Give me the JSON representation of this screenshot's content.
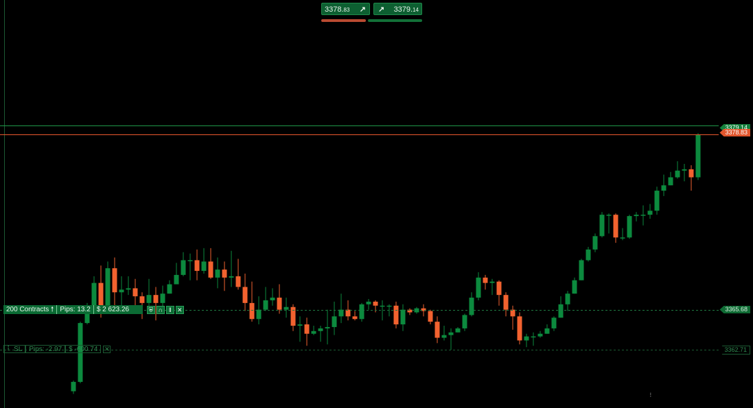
{
  "quote": {
    "sell": {
      "main": "3378.",
      "frac": "83"
    },
    "buy": {
      "main": "3379.",
      "frac": "14"
    }
  },
  "order": {
    "contracts_label": "200 Contracts",
    "pips_label": "Pips: 13.2",
    "pnl_label": "$ 2 623.26",
    "icons": [
      "shield-icon",
      "magnet-icon",
      "pause-icon",
      "close-icon"
    ]
  },
  "stop_loss": {
    "label": "SL",
    "pips_label": "Pips: -2.97",
    "pnl_label": "$ -600.74"
  },
  "price_tags": {
    "ask": "3379.14",
    "bid": "3378.83",
    "entry": "3365.68",
    "stop_loss": "3362.71"
  },
  "colors": {
    "bull": "#0c8a3e",
    "bear": "#f2622f",
    "ask_line": "#1f9a4a",
    "bid_line": "#ef5a2e"
  },
  "chart_data": {
    "type": "candlestick",
    "price_levels": {
      "ask": 3379.14,
      "bid": 3378.83,
      "entry": 3365.68,
      "stop_loss": 3362.71
    },
    "candles": [
      [
        3359.6,
        3360.3,
        3359.4,
        3360.4
      ],
      [
        3360.3,
        3364.7,
        3360.2,
        3364.8
      ],
      [
        3364.7,
        3365.8,
        3364.6,
        3366.2
      ],
      [
        3365.8,
        3367.7,
        3365.8,
        3368.2
      ],
      [
        3367.7,
        3365.8,
        3365.1,
        3369.0
      ],
      [
        3365.8,
        3368.8,
        3365.5,
        3369.3
      ],
      [
        3368.8,
        3367.0,
        3365.8,
        3369.6
      ],
      [
        3367.0,
        3367.2,
        3365.8,
        3368.2
      ],
      [
        3367.2,
        3367.3,
        3366.8,
        3368.2
      ],
      [
        3367.3,
        3366.7,
        3365.8,
        3368.0
      ],
      [
        3366.7,
        3366.2,
        3365.0,
        3367.0
      ],
      [
        3366.2,
        3366.8,
        3366.0,
        3368.0
      ],
      [
        3366.8,
        3366.2,
        3364.9,
        3367.4
      ],
      [
        3366.2,
        3366.9,
        3365.6,
        3367.5
      ],
      [
        3366.9,
        3367.6,
        3366.9,
        3367.9
      ],
      [
        3367.6,
        3368.3,
        3367.6,
        3369.2
      ],
      [
        3368.3,
        3369.4,
        3368.2,
        3370.0
      ],
      [
        3369.4,
        3369.4,
        3367.9,
        3369.9
      ],
      [
        3369.4,
        3368.6,
        3367.9,
        3370.2
      ],
      [
        3368.6,
        3369.3,
        3368.4,
        3370.3
      ],
      [
        3369.3,
        3368.1,
        3368.0,
        3370.3
      ],
      [
        3368.1,
        3368.7,
        3367.3,
        3369.6
      ],
      [
        3368.7,
        3368.1,
        3367.1,
        3369.3
      ],
      [
        3368.1,
        3368.2,
        3367.4,
        3370.1
      ],
      [
        3368.2,
        3367.4,
        3367.2,
        3369.5
      ],
      [
        3367.4,
        3366.2,
        3365.6,
        3368.4
      ],
      [
        3366.2,
        3365.0,
        3364.8,
        3367.8
      ],
      [
        3365.0,
        3365.7,
        3364.6,
        3366.7
      ],
      [
        3365.7,
        3366.4,
        3365.6,
        3367.4
      ],
      [
        3366.4,
        3366.6,
        3366.0,
        3367.3
      ],
      [
        3366.6,
        3365.7,
        3365.4,
        3367.6
      ],
      [
        3365.7,
        3365.9,
        3365.1,
        3366.6
      ],
      [
        3365.9,
        3364.5,
        3364.1,
        3366.1
      ],
      [
        3364.5,
        3364.6,
        3363.3,
        3365.2
      ],
      [
        3364.6,
        3363.9,
        3363.0,
        3365.1
      ],
      [
        3363.9,
        3364.1,
        3363.8,
        3364.5
      ],
      [
        3364.1,
        3364.3,
        3363.3,
        3364.5
      ],
      [
        3364.3,
        3364.4,
        3363.1,
        3365.7
      ],
      [
        3364.4,
        3365.2,
        3363.8,
        3366.3
      ],
      [
        3365.2,
        3365.7,
        3364.7,
        3366.9
      ],
      [
        3365.7,
        3365.2,
        3364.9,
        3366.4
      ],
      [
        3365.2,
        3365.0,
        3364.9,
        3365.6
      ],
      [
        3365.0,
        3366.1,
        3364.8,
        3366.2
      ],
      [
        3366.1,
        3366.3,
        3365.7,
        3366.5
      ],
      [
        3366.3,
        3366.0,
        3365.5,
        3366.4
      ],
      [
        3366.0,
        3366.0,
        3364.9,
        3366.4
      ],
      [
        3366.0,
        3366.0,
        3365.2,
        3366.1
      ],
      [
        3366.0,
        3364.6,
        3364.3,
        3366.3
      ],
      [
        3364.6,
        3365.7,
        3364.1,
        3366.1
      ],
      [
        3365.7,
        3365.5,
        3365.3,
        3365.8
      ],
      [
        3365.5,
        3365.8,
        3365.4,
        3365.9
      ],
      [
        3365.8,
        3365.6,
        3365.2,
        3366.1
      ],
      [
        3365.6,
        3364.8,
        3364.6,
        3365.7
      ],
      [
        3364.8,
        3363.6,
        3363.2,
        3365.2
      ],
      [
        3363.6,
        3363.8,
        3363.4,
        3364.5
      ],
      [
        3363.8,
        3364.0,
        3362.7,
        3364.3
      ],
      [
        3364.0,
        3364.3,
        3364.0,
        3364.4
      ],
      [
        3364.3,
        3365.3,
        3364.1,
        3365.4
      ],
      [
        3365.3,
        3366.6,
        3365.2,
        3367.0
      ],
      [
        3366.6,
        3368.1,
        3366.4,
        3368.5
      ],
      [
        3368.1,
        3367.7,
        3367.2,
        3368.3
      ],
      [
        3367.7,
        3367.8,
        3366.8,
        3368.0
      ],
      [
        3367.8,
        3366.8,
        3366.0,
        3367.9
      ],
      [
        3366.8,
        3365.7,
        3365.2,
        3367.0
      ],
      [
        3365.7,
        3365.2,
        3364.2,
        3366.0
      ],
      [
        3365.2,
        3363.4,
        3363.1,
        3365.5
      ],
      [
        3363.4,
        3363.7,
        3362.9,
        3363.9
      ],
      [
        3363.7,
        3363.7,
        3363.0,
        3364.0
      ],
      [
        3363.7,
        3363.9,
        3363.6,
        3364.1
      ],
      [
        3363.9,
        3364.3,
        3363.9,
        3364.6
      ],
      [
        3364.3,
        3365.1,
        3364.1,
        3365.2
      ],
      [
        3365.1,
        3366.1,
        3365.1,
        3366.7
      ],
      [
        3366.1,
        3366.9,
        3365.6,
        3367.1
      ],
      [
        3366.9,
        3367.9,
        3366.9,
        3368.1
      ],
      [
        3367.9,
        3369.4,
        3367.9,
        3369.5
      ],
      [
        3369.4,
        3370.2,
        3369.3,
        3370.4
      ],
      [
        3370.2,
        3371.2,
        3370.0,
        3371.4
      ],
      [
        3371.2,
        3372.8,
        3371.1,
        3373.0
      ],
      [
        3372.8,
        3372.8,
        3371.4,
        3372.9
      ],
      [
        3372.8,
        3371.1,
        3370.7,
        3372.9
      ],
      [
        3371.1,
        3371.1,
        3370.9,
        3371.8
      ],
      [
        3371.1,
        3372.7,
        3371.0,
        3372.8
      ],
      [
        3372.7,
        3372.8,
        3372.3,
        3373.0
      ],
      [
        3372.8,
        3372.8,
        3372.0,
        3373.5
      ],
      [
        3372.8,
        3373.1,
        3372.5,
        3373.6
      ],
      [
        3373.1,
        3374.6,
        3372.8,
        3374.9
      ],
      [
        3374.6,
        3375.0,
        3374.2,
        3375.8
      ],
      [
        3375.0,
        3375.6,
        3375.0,
        3376.0
      ],
      [
        3375.6,
        3376.1,
        3375.5,
        3376.8
      ],
      [
        3376.1,
        3376.2,
        3375.3,
        3376.6
      ],
      [
        3376.2,
        3375.6,
        3374.6,
        3376.5
      ],
      [
        3375.6,
        3378.8,
        3375.4,
        3378.9
      ]
    ]
  }
}
